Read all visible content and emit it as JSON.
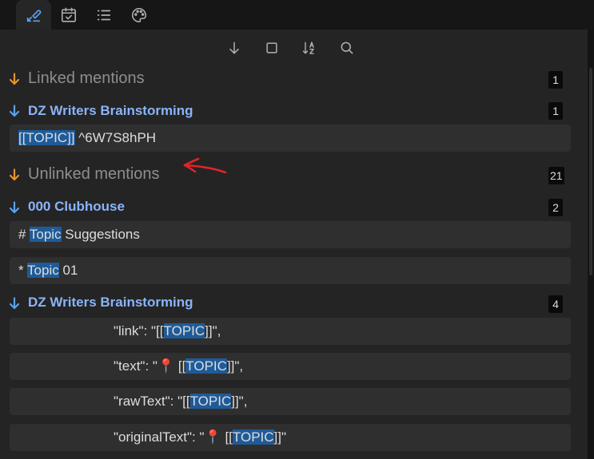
{
  "tabs": [
    {
      "name": "backlinks",
      "icon": "backlink-icon",
      "active": true
    },
    {
      "name": "calendar",
      "icon": "calendar-check-icon",
      "active": false
    },
    {
      "name": "outline",
      "icon": "list-icon",
      "active": false
    },
    {
      "name": "style-settings",
      "icon": "palette-icon",
      "active": false
    }
  ],
  "toolbar": {
    "buttons": [
      "collapse-arrow-icon",
      "square-icon",
      "sort-az-icon",
      "search-icon"
    ]
  },
  "linked": {
    "title": "Linked mentions",
    "count": "1",
    "groups": [
      {
        "title": "DZ Writers Brainstorming",
        "count": "1",
        "items": [
          {
            "pre": "",
            "highlight": "[[TOPIC]]",
            "post": " ^6W7S8hPH"
          }
        ]
      }
    ]
  },
  "unlinked": {
    "title": "Unlinked mentions",
    "count": "21",
    "groups": [
      {
        "title": "000 Clubhouse",
        "count": "2",
        "items": [
          {
            "pre": "# ",
            "highlight": "Topic",
            "post": " Suggestions"
          },
          {
            "pre": "* ",
            "highlight": "Topic",
            "post": " 01"
          }
        ]
      },
      {
        "title": "DZ Writers Brainstorming",
        "count": "4",
        "items": [
          {
            "pre": "\"link\": \"[[",
            "pin": "",
            "highlight": "TOPIC",
            "post": "]]\","
          },
          {
            "pre": "\"text\": \"",
            "pin": "📍",
            "mid": " [[",
            "highlight": "TOPIC",
            "post": "]]\","
          },
          {
            "pre": "\"rawText\": \"[[",
            "pin": "",
            "highlight": "TOPIC",
            "post": "]]\","
          },
          {
            "pre": "\"originalText\": \"",
            "pin": "📍",
            "mid": " [[",
            "highlight": "TOPIC",
            "post": "]]\""
          }
        ]
      }
    ]
  },
  "colors": {
    "section_arrow": "#e8932c",
    "group_arrow": "#5ba1f0",
    "group_title": "#8ab4f8",
    "highlight_bg": "#1f5b99",
    "annotation": "#e0242a"
  }
}
